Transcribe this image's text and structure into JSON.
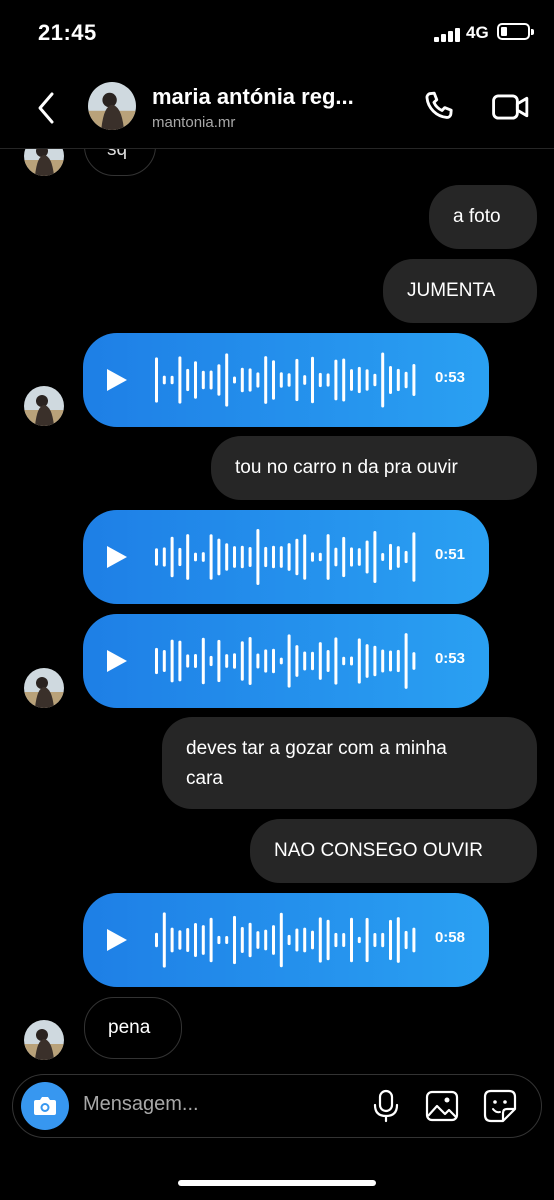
{
  "status_bar": {
    "time": "21:45",
    "network": "4G"
  },
  "header": {
    "name": "maria antónia reg...",
    "username": "mantonia.mr"
  },
  "messages": {
    "partial_top": "sq",
    "m1": "a foto",
    "m2": "JUMENTA",
    "voice1_duration": "0:53",
    "m3": "tou no carro n da pra ouvir",
    "voice2_duration": "0:51",
    "voice3_duration": "0:53",
    "m4_line1": "deves tar a gozar com a minha",
    "m4_line2": "cara",
    "m5": "NAO CONSEGO OUVIR",
    "voice4_duration": "0:58",
    "m6": "pena"
  },
  "composer": {
    "placeholder": "Mensagem..."
  },
  "colors": {
    "voice_start": "#1e7fe6",
    "voice_end": "#2aa0f2",
    "camera_button": "#3797f0",
    "outgoing_bubble": "#262626"
  },
  "icons": [
    "back-chevron-icon",
    "phone-icon",
    "video-camera-icon",
    "play-icon",
    "waveform-icon",
    "camera-icon",
    "microphone-icon",
    "gallery-icon",
    "sticker-icon"
  ]
}
